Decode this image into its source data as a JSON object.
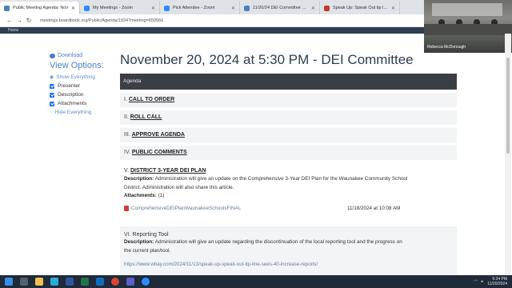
{
  "browser": {
    "tabs": [
      {
        "label": "Public Meeting Agenda: Nov",
        "color": "#4a7fc1",
        "active": true
      },
      {
        "label": "My Meetings - Zoom",
        "color": "#2d8cff",
        "active": false
      },
      {
        "label": "Pick Attendee - Zoom",
        "color": "#2d8cff",
        "active": false
      },
      {
        "label": "11/20/24 DEI Committee Meeti",
        "color": "#4a7fc1",
        "active": false
      },
      {
        "label": "Speak Up: Speak Out tip line",
        "color": "#c0392b",
        "active": false
      }
    ],
    "url": "meetings.boardbook.org/Public/Agenda/1924?meeting=659566"
  },
  "site": {
    "home_label": "Home"
  },
  "video": {
    "speaker": "Rebecca McDonough"
  },
  "options": {
    "download_label": "Download",
    "title": "View Options:",
    "show_everything": "Show Everything",
    "presenter": "Presenter",
    "description": "Description",
    "attachments": "Attachments",
    "hide_everything": "Hide Everything"
  },
  "meeting": {
    "title": "November 20, 2024 at 5:30 PM - DEI Committee",
    "agenda_header": "Agenda"
  },
  "items": [
    {
      "num": "I.",
      "name": "CALL TO ORDER"
    },
    {
      "num": "II.",
      "name": "ROLL CALL"
    },
    {
      "num": "III.",
      "name": "APPROVE AGENDA"
    },
    {
      "num": "IV.",
      "name": "PUBLIC COMMENTS"
    },
    {
      "num": "V.",
      "name": "DISTRICT 3-YEAR DEI PLAN",
      "desc_label": "Description:",
      "desc_line1": "Administration will give an update on the Comprehensive 3-Year DEI Plan for the Waunakee Community School",
      "desc_line2": "District.  Administration will also share this article.",
      "attach_label": "Attachments:",
      "attach_count": "(1)",
      "attach_file": "ComprehensiveDEIPlanWaunakeeSchoolsFINAL",
      "attach_date": "11/18/2024 at 10:08 AM"
    },
    {
      "num": "VI.",
      "name": "Reporting Tool",
      "desc_label": "Description:",
      "desc_line1": "Administration will give an update regarding the discontinuation of the local reporting tool and the progress on",
      "desc_line2": "the current plan/tool.",
      "link": "https://www.wbay.com/2024/11/13/speak-up-speak-out-tip-line-sees-40-increase-reports/"
    }
  ],
  "taskbar": {
    "time": "5:34 PM",
    "date": "11/20/2024"
  }
}
